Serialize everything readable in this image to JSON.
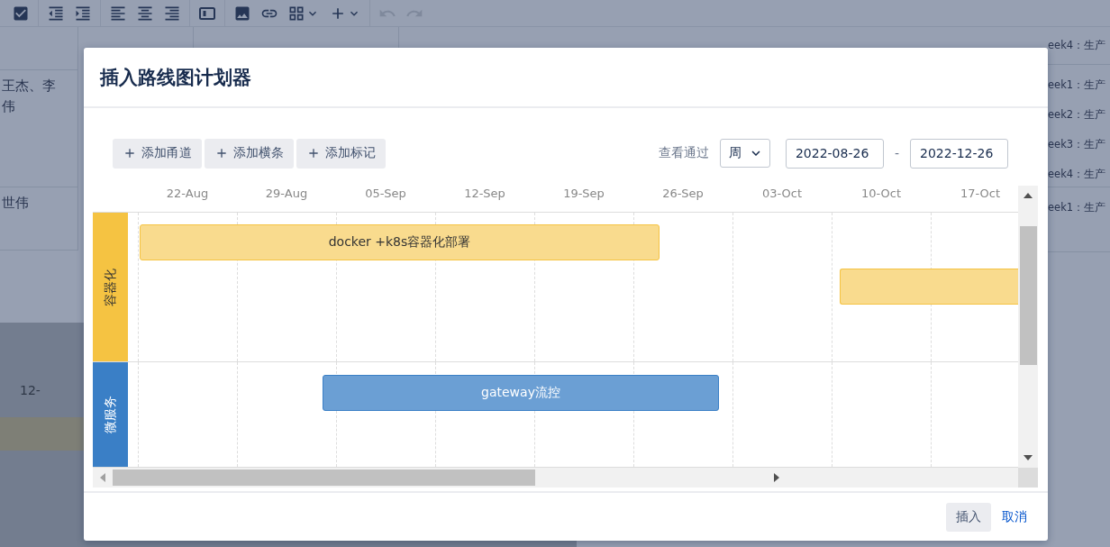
{
  "toolbar": {
    "buttons": [
      {
        "disabled": false
      },
      {
        "disabled": false
      },
      {
        "disabled": false
      },
      {
        "disabled": false
      },
      {
        "disabled": false
      },
      {
        "disabled": false
      },
      {
        "disabled": false
      },
      {
        "disabled": false
      },
      {
        "disabled": false
      },
      {
        "disabled": false
      },
      {
        "disabled": false
      },
      {
        "disabled": true
      },
      {
        "disabled": true
      }
    ]
  },
  "background_table": {
    "left_rows": [
      {
        "lines": []
      },
      {
        "lines": [
          "王杰、李",
          "伟"
        ]
      },
      {
        "lines": [
          "世伟"
        ]
      }
    ],
    "left_footer": "12-",
    "right_rows": [
      {
        "lines": [
          "eek4：生产"
        ]
      },
      {
        "lines": [
          "eek1：生产",
          "eek2：生产",
          "eek3：生产",
          "eek4：生产"
        ]
      },
      {
        "lines": [
          "eek1：生产"
        ]
      }
    ]
  },
  "dialog": {
    "title": "插入路线图计划器",
    "actions": [
      "添加甬道",
      "添加横条",
      "添加标记"
    ],
    "view_by_label": "查看通过",
    "view_by": "周",
    "start_date": "2022-08-26",
    "date_separator": "-",
    "end_date": "2022-12-26",
    "timeline": [
      "22-Aug",
      "29-Aug",
      "05-Sep",
      "12-Sep",
      "19-Sep",
      "26-Sep",
      "03-Oct",
      "10-Oct",
      "17-Oct"
    ],
    "lanes": [
      {
        "name": "容器化",
        "color": "#f5c342",
        "bars": [
          {
            "label": "docker +k8s容器化部署",
            "clipped": false
          },
          {
            "clipped": true
          }
        ]
      },
      {
        "name": "微服务",
        "color": "#3a7fc6",
        "bars": [
          {
            "label": "gateway流控",
            "clipped": false
          }
        ]
      }
    ],
    "insert": "插入",
    "cancel": "取消"
  }
}
